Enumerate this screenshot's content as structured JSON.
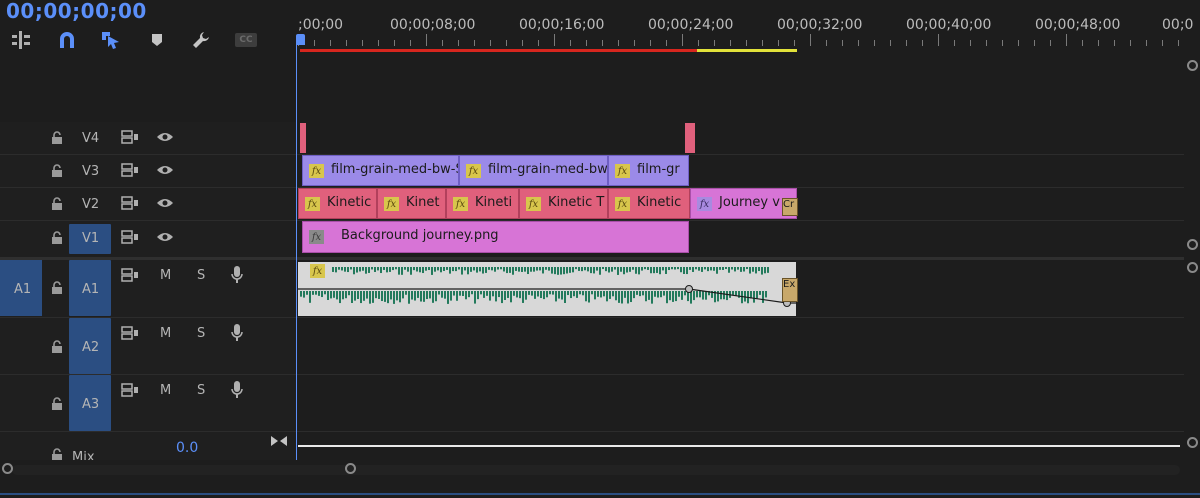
{
  "timecode": "00;00;00;00",
  "toolbar": {
    "cc_label": "CC"
  },
  "ruler": {
    "labels": [
      ";00;00",
      "00;00;08;00",
      "00;00;16;00",
      "00;00;24;00",
      "00;00;32;00",
      "00;00;40;00",
      "00;00;48;00",
      "00;0"
    ]
  },
  "tracks": {
    "v4": "V4",
    "v3": "V3",
    "v2": "V2",
    "v1": "V1",
    "a1_src": "A1",
    "a1": "A1",
    "a2": "A2",
    "a3": "A3",
    "mute": "M",
    "solo": "S",
    "mix_label": "Mix",
    "mix_value": "0.0"
  },
  "clips": {
    "v3": [
      "film-grain-med-bw-S",
      "film-grain-med-bw-",
      "film-gr"
    ],
    "v2": [
      "Kinetic",
      "Kinet",
      "Kineti",
      "Kinetic T",
      "Kinetic",
      "Journey v"
    ],
    "v2_tail": "Cr",
    "v1": "Background journey.png",
    "a1_tail": "Ex"
  },
  "colors": {
    "accent": "#5b8ff9",
    "clip_pink": "#e0607c",
    "clip_purple": "#9b8ae8",
    "clip_magenta": "#d774d6",
    "audio_clip": "#d8d8d8",
    "waveform": "#237a5c",
    "render_red": "#d7261e",
    "render_yellow": "#e2e23a"
  }
}
